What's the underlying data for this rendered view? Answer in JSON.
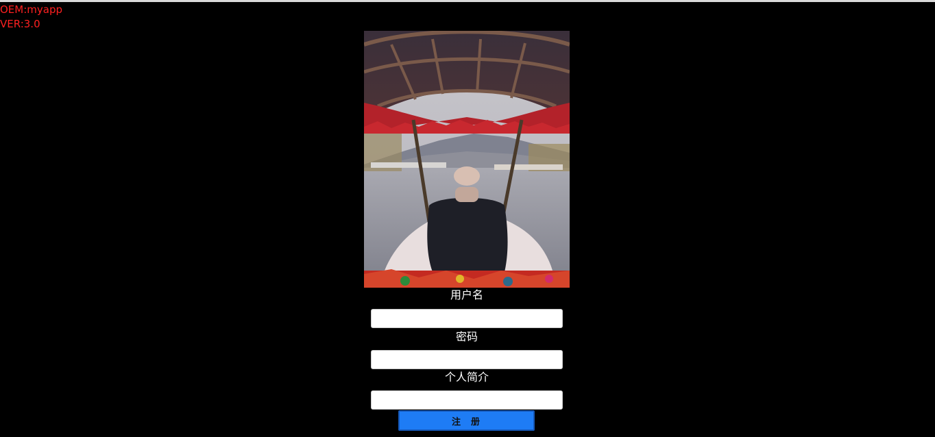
{
  "app": {
    "oem": "OEM:myapp",
    "version": "VER:3.0"
  },
  "colors": {
    "background": "#000000",
    "info_text": "#ff2020",
    "button": "#1e7cf5"
  },
  "form": {
    "username": {
      "label": "用户名",
      "value": ""
    },
    "password": {
      "label": "密码",
      "value": ""
    },
    "bio": {
      "label": "个人简介",
      "value": ""
    },
    "submit_label": "注  册"
  }
}
